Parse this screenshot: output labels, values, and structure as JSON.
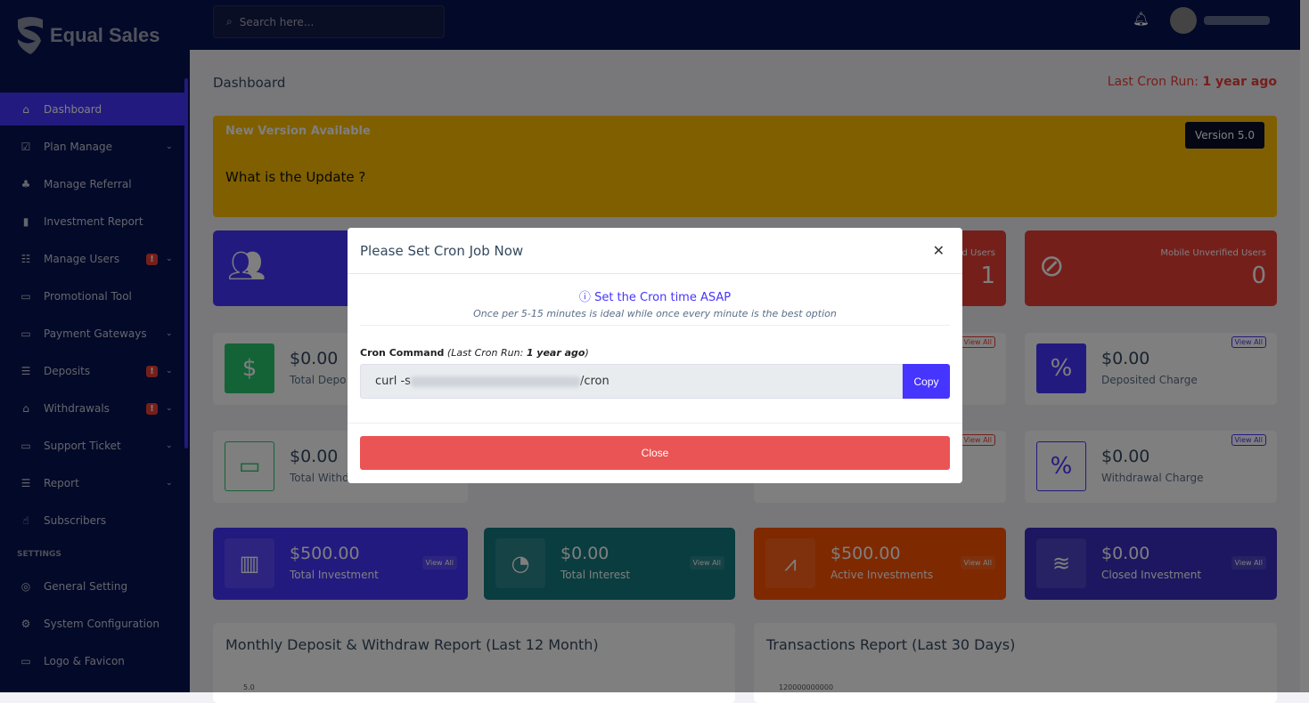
{
  "brand": {
    "name": "Equal Sales"
  },
  "topbar": {
    "search_placeholder": "Search here...",
    "bell_icon": "bell-icon"
  },
  "sidebar": {
    "items": [
      {
        "label": "Dashboard",
        "icon": "⌂",
        "active": true
      },
      {
        "label": "Plan Manage",
        "icon": "☑",
        "chevron": true
      },
      {
        "label": "Manage Referral",
        "icon": "♣"
      },
      {
        "label": "Investment Report",
        "icon": "▮"
      },
      {
        "label": "Manage Users",
        "icon": "☷",
        "badge": "!",
        "chevron": true
      },
      {
        "label": "Promotional Tool",
        "icon": "▭"
      },
      {
        "label": "Payment Gateways",
        "icon": "▭",
        "chevron": true
      },
      {
        "label": "Deposits",
        "icon": "☰",
        "badge": "!",
        "chevron": true
      },
      {
        "label": "Withdrawals",
        "icon": "⌂",
        "badge": "!",
        "chevron": true
      },
      {
        "label": "Support Ticket",
        "icon": "▭",
        "chevron": true
      },
      {
        "label": "Report",
        "icon": "☰",
        "chevron": true
      },
      {
        "label": "Subscribers",
        "icon": "☝"
      }
    ],
    "settings_title": "SETTINGS",
    "settings_items": [
      {
        "label": "General Setting",
        "icon": "◎"
      },
      {
        "label": "System Configuration",
        "icon": "⚙"
      },
      {
        "label": "Logo & Favicon",
        "icon": "▭"
      }
    ]
  },
  "page": {
    "title": "Dashboard",
    "cron_label": "Last Cron Run:",
    "cron_value": "1 year ago"
  },
  "banner": {
    "title": "New Version Available",
    "question": "What is the Update ?",
    "version": "Version 5.0",
    "color": "#ffbf00"
  },
  "row1": [
    {
      "label": "",
      "value": "",
      "color": "#4634ff"
    },
    {
      "label": "d Users",
      "value": "1",
      "color": "#ea3f36"
    },
    {
      "label": "Mobile Unverified Users",
      "value": "0",
      "color": "#ea3f36"
    }
  ],
  "row2": [
    {
      "amount": "$0.00",
      "label": "Total Depo"
    },
    {
      "amount": "$0.00",
      "label": "Deposited Charge",
      "view": "View All"
    },
    {
      "view": "View All"
    }
  ],
  "row3": [
    {
      "amount": "$0.00",
      "label": "Total Withd"
    },
    {
      "amount": "$0.00",
      "label": "Withdrawal Charge",
      "view": "View All"
    },
    {
      "view": "View All"
    }
  ],
  "row4": [
    {
      "amount": "$500.00",
      "label": "Total Investment",
      "view": "View All",
      "color": "#4634ff"
    },
    {
      "amount": "$0.00",
      "label": "Total Interest",
      "view": "View All",
      "color": "#147a80"
    },
    {
      "amount": "$500.00",
      "label": "Active Investments",
      "view": "View All",
      "color": "#ff5200"
    },
    {
      "amount": "$0.00",
      "label": "Closed Investment",
      "view": "View All",
      "color": "#382fc0"
    }
  ],
  "charts": [
    {
      "title": "Monthly Deposit & Withdraw Report (Last 12 Month)",
      "tick": "5.0"
    },
    {
      "title": "Transactions Report (Last 30 Days)",
      "tick": "120000000000"
    }
  ],
  "modal": {
    "title": "Please Set Cron Job Now",
    "info": "Set the Cron time ASAP",
    "sub": "Once per 5-15 minutes is ideal while once every minute is the best option",
    "cmd_label": "Cron Command",
    "cmd_note_prefix": "(Last Cron Run:",
    "cmd_note_value": "1 year ago",
    "cmd_note_suffix": ")",
    "cmd_value": "curl -s",
    "cmd_tail": "/cron",
    "copy": "Copy",
    "close": "Close"
  }
}
